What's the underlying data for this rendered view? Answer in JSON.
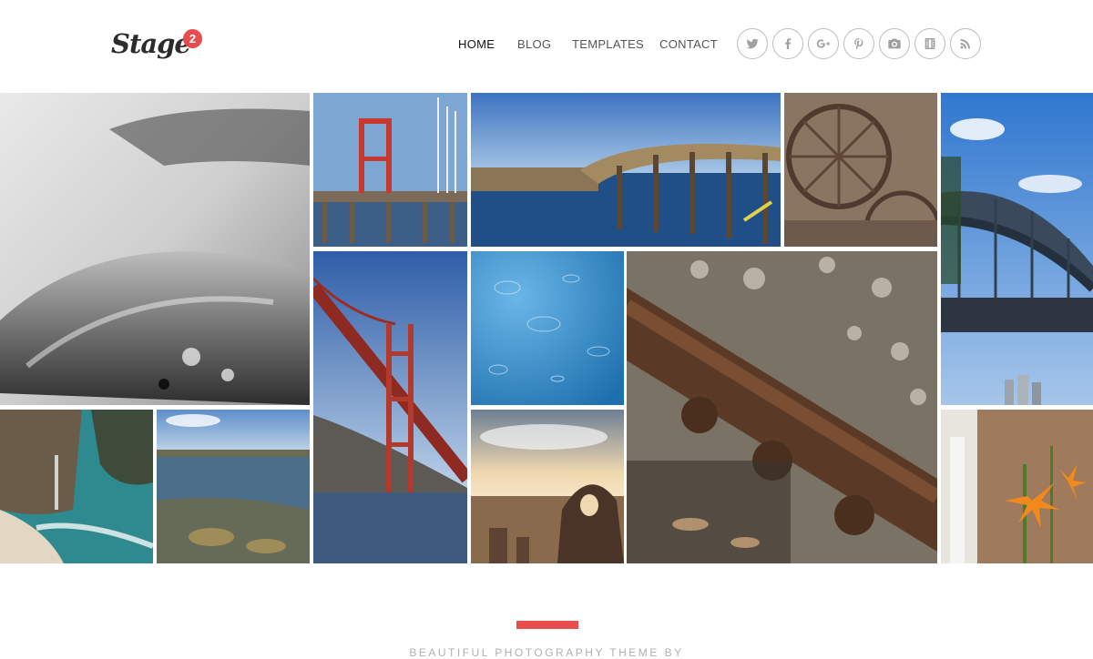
{
  "brand": {
    "name": "Stage",
    "badge": "2"
  },
  "nav": {
    "items": [
      {
        "label": "HOME",
        "active": true
      },
      {
        "label": "BLOG",
        "active": false
      },
      {
        "label": "TEMPLATES",
        "active": false
      },
      {
        "label": "CONTACT",
        "active": false
      }
    ]
  },
  "social": {
    "icons": [
      "twitter-icon",
      "facebook-icon",
      "google-plus-icon",
      "pinterest-icon",
      "camera-icon",
      "film-icon",
      "rss-icon"
    ]
  },
  "gallery": {
    "photos": [
      "weathered-pipe-bw",
      "red-tower-on-pier",
      "wooden-bridge-over-water",
      "rusty-wagon-wheels",
      "harbour-bridge-arch",
      "golden-gate-bridge",
      "raindrops-on-water",
      "railway-track-bolts",
      "waterfall-beach-cove",
      "shallow-sea-rocks",
      "sunset-rock-arch",
      "orange-lily"
    ]
  },
  "footer": {
    "tagline": "BEAUTIFUL PHOTOGRAPHY THEME BY"
  },
  "colors": {
    "accent": "#e84c4c",
    "text": "#333333"
  }
}
